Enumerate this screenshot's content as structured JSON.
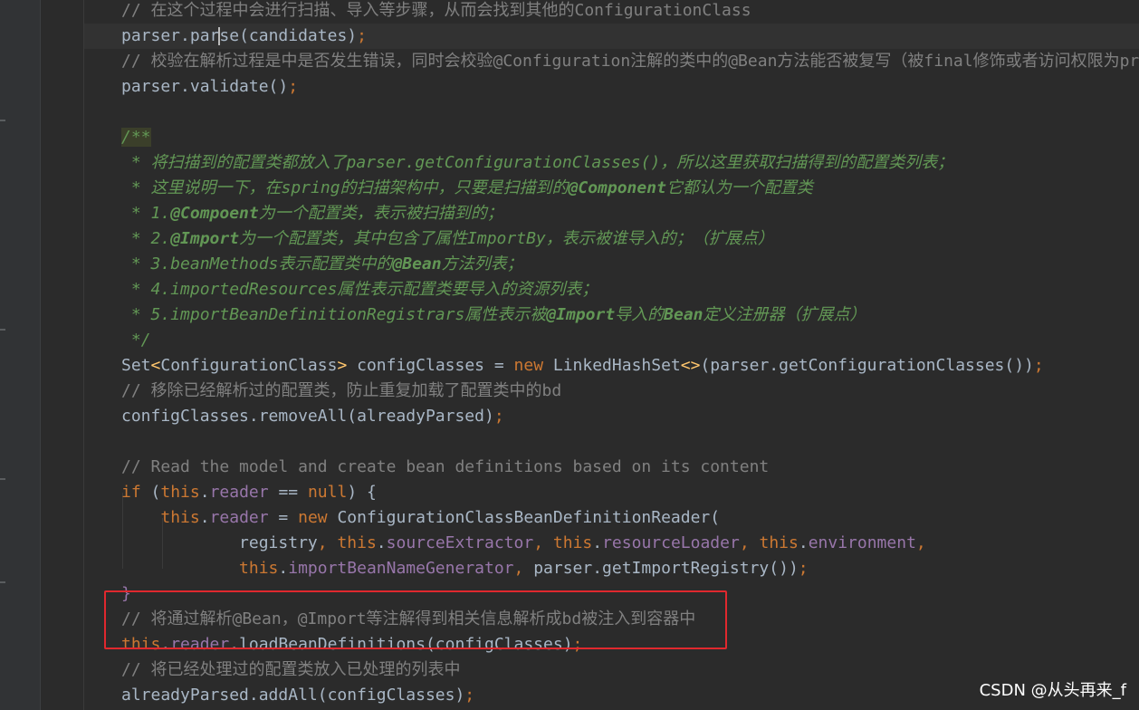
{
  "editor": {
    "lines": [
      {
        "id": "l0",
        "segments": [
          {
            "t": "// 在这个过程中会进行扫描、导入等步骤，从而会找到其他的ConfigurationClass",
            "c": "comment"
          }
        ]
      },
      {
        "id": "l1",
        "segments": [
          {
            "t": "parser.pa",
            "c": ""
          },
          {
            "t": "r",
            "c": "caret-after"
          },
          {
            "t": "se",
            "c": ""
          },
          {
            "t": "(candidates)",
            "c": ""
          },
          {
            "t": ";",
            "c": "kw"
          }
        ]
      },
      {
        "id": "l2",
        "segments": [
          {
            "t": "// 校验在解析过程是中是否发生错误，同时会校验@Configuration注解的类中的@Bean方法能否被复写（被final修饰或者访问权限为pr",
            "c": "comment"
          }
        ]
      },
      {
        "id": "l3",
        "segments": [
          {
            "t": "parser.validate()",
            "c": ""
          },
          {
            "t": ";",
            "c": "kw"
          }
        ]
      },
      {
        "id": "l4",
        "segments": []
      },
      {
        "id": "l5",
        "segments": [
          {
            "t": "/**",
            "c": "doc-start"
          }
        ]
      },
      {
        "id": "l6",
        "segments": [
          {
            "t": " * 将扫描到的配置类都放入了parser.getConfigurationClasses()，所以这里获取扫描得到的配置类列表；",
            "c": "doc"
          }
        ]
      },
      {
        "id": "l7",
        "segments": [
          {
            "t": " * 这里说明一下，在spring的扫描架构中，只要是扫描到的",
            "c": "doc"
          },
          {
            "t": "@Component",
            "c": "doc-tag"
          },
          {
            "t": "它都认为一个配置类",
            "c": "doc"
          }
        ]
      },
      {
        "id": "l8",
        "segments": [
          {
            "t": " * 1.",
            "c": "doc"
          },
          {
            "t": "@Compoent",
            "c": "doc-tag"
          },
          {
            "t": "为一个配置类，表示被扫描到的；",
            "c": "doc"
          }
        ]
      },
      {
        "id": "l9",
        "segments": [
          {
            "t": " * 2.",
            "c": "doc"
          },
          {
            "t": "@Import",
            "c": "doc-tag"
          },
          {
            "t": "为一个配置类，其中包含了属性ImportBy，表示被谁导入的；（扩展点）",
            "c": "doc"
          }
        ]
      },
      {
        "id": "l10",
        "segments": [
          {
            "t": " * 3.beanMethods表示配置类中的",
            "c": "doc"
          },
          {
            "t": "@Bean",
            "c": "doc-tag"
          },
          {
            "t": "方法列表；",
            "c": "doc"
          }
        ]
      },
      {
        "id": "l11",
        "segments": [
          {
            "t": " * 4.importedResources属性表示配置类要导入的资源列表；",
            "c": "doc"
          }
        ]
      },
      {
        "id": "l12",
        "segments": [
          {
            "t": " * 5.importBeanDefinitionRegistrars属性表示被",
            "c": "doc"
          },
          {
            "t": "@Import",
            "c": "doc-tag"
          },
          {
            "t": "导入的",
            "c": "doc"
          },
          {
            "t": "Bean",
            "c": "doc-tag"
          },
          {
            "t": "定义注册器（扩展点）",
            "c": "doc"
          }
        ]
      },
      {
        "id": "l13",
        "segments": [
          {
            "t": " */",
            "c": "doc"
          }
        ]
      },
      {
        "id": "l14",
        "segments": [
          {
            "t": "Set",
            "c": ""
          },
          {
            "t": "<",
            "c": "method"
          },
          {
            "t": "ConfigurationClass",
            "c": ""
          },
          {
            "t": ">",
            "c": "method"
          },
          {
            "t": " configClasses = ",
            "c": ""
          },
          {
            "t": "new",
            "c": "kw"
          },
          {
            "t": " LinkedHashSet",
            "c": ""
          },
          {
            "t": "<>",
            "c": "method"
          },
          {
            "t": "(parser.getConfigurationClasses())",
            "c": ""
          },
          {
            "t": ";",
            "c": "kw"
          }
        ]
      },
      {
        "id": "l15",
        "segments": [
          {
            "t": "// 移除已经解析过的配置类，防止重复加载了配置类中的bd",
            "c": "comment"
          }
        ]
      },
      {
        "id": "l16",
        "segments": [
          {
            "t": "configClasses.removeAll(alreadyParsed)",
            "c": ""
          },
          {
            "t": ";",
            "c": "kw"
          }
        ]
      },
      {
        "id": "l17",
        "segments": []
      },
      {
        "id": "l18",
        "segments": [
          {
            "t": "// Read the model and create bean definitions based on its content",
            "c": "comment"
          }
        ]
      },
      {
        "id": "l19",
        "segments": [
          {
            "t": "if",
            "c": "kw"
          },
          {
            "t": " (",
            "c": ""
          },
          {
            "t": "this",
            "c": "kw"
          },
          {
            "t": ".",
            "c": ""
          },
          {
            "t": "reader",
            "c": "field"
          },
          {
            "t": " == ",
            "c": ""
          },
          {
            "t": "null",
            "c": "kw"
          },
          {
            "t": ") {",
            "c": ""
          }
        ]
      },
      {
        "id": "l20",
        "segments": [
          {
            "t": "    ",
            "c": ""
          },
          {
            "t": "this",
            "c": "kw"
          },
          {
            "t": ".",
            "c": ""
          },
          {
            "t": "reader",
            "c": "field"
          },
          {
            "t": " = ",
            "c": ""
          },
          {
            "t": "new",
            "c": "kw"
          },
          {
            "t": " ConfigurationClassBeanDefinitionReader(",
            "c": ""
          }
        ]
      },
      {
        "id": "l21",
        "segments": [
          {
            "t": "            registry",
            "c": ""
          },
          {
            "t": ", ",
            "c": "kw"
          },
          {
            "t": "this",
            "c": "kw"
          },
          {
            "t": ".",
            "c": ""
          },
          {
            "t": "sourceExtractor",
            "c": "field"
          },
          {
            "t": ", ",
            "c": "kw"
          },
          {
            "t": "this",
            "c": "kw"
          },
          {
            "t": ".",
            "c": ""
          },
          {
            "t": "resourceLoader",
            "c": "field"
          },
          {
            "t": ", ",
            "c": "kw"
          },
          {
            "t": "this",
            "c": "kw"
          },
          {
            "t": ".",
            "c": ""
          },
          {
            "t": "environment",
            "c": "field"
          },
          {
            "t": ",",
            "c": "kw"
          }
        ]
      },
      {
        "id": "l22",
        "segments": [
          {
            "t": "            ",
            "c": ""
          },
          {
            "t": "this",
            "c": "kw"
          },
          {
            "t": ".",
            "c": ""
          },
          {
            "t": "importBeanNameGenerator",
            "c": "field"
          },
          {
            "t": ", ",
            "c": "kw"
          },
          {
            "t": "parser.getImportRegistry())",
            "c": ""
          },
          {
            "t": ";",
            "c": "kw"
          }
        ]
      },
      {
        "id": "l23",
        "segments": [
          {
            "t": "}",
            "c": "brace"
          }
        ]
      },
      {
        "id": "l24",
        "segments": [
          {
            "t": "// 将通过解析@Bean，@Import等注解得到相关信息解析成bd被注入到容器中",
            "c": "comment"
          }
        ]
      },
      {
        "id": "l25",
        "segments": [
          {
            "t": "this",
            "c": "kw"
          },
          {
            "t": ".",
            "c": ""
          },
          {
            "t": "reader",
            "c": "field"
          },
          {
            "t": ".loadBeanDefinitions(configClasses)",
            "c": ""
          },
          {
            "t": ";",
            "c": "kw"
          }
        ]
      },
      {
        "id": "l26",
        "segments": [
          {
            "t": "// 将已经处理过的配置类放入已处理的列表中",
            "c": "comment"
          }
        ]
      },
      {
        "id": "l27",
        "segments": [
          {
            "t": "alreadyParsed.addAll(configClasses)",
            "c": ""
          },
          {
            "t": ";",
            "c": "kw"
          }
        ]
      }
    ]
  },
  "watermark": "CSDN @从头再来_f",
  "colors": {
    "background": "#2b2b2b",
    "keyword": "#cc7832",
    "field": "#9876aa",
    "comment": "#808080",
    "doc_comment": "#629755",
    "highlight_box": "#e0282e"
  }
}
